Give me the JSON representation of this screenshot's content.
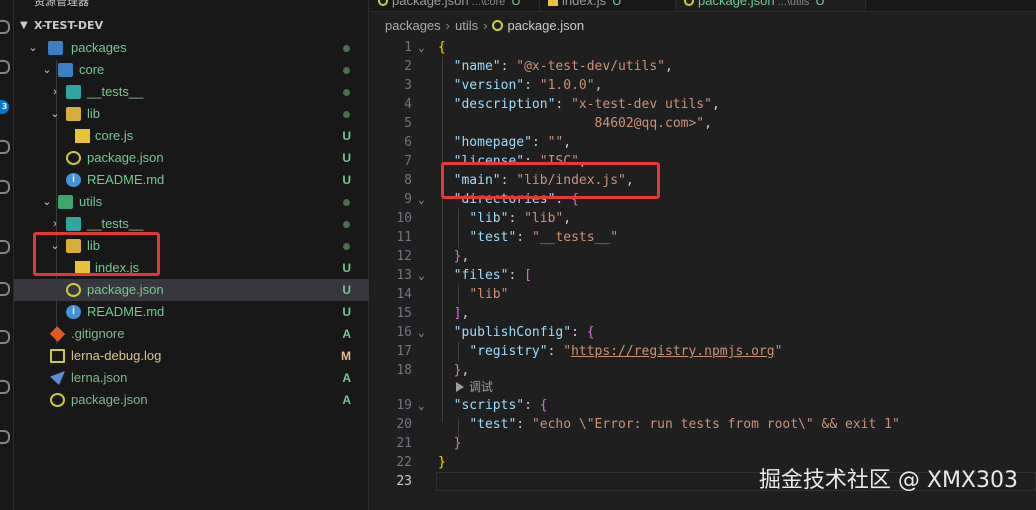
{
  "explorer": {
    "title": "资源管理器",
    "section": "X-TEST-DEV",
    "items": [
      {
        "name": "packages",
        "status": "dot"
      },
      {
        "name": "core",
        "status": "dot"
      },
      {
        "name": "__tests__",
        "status": "dot"
      },
      {
        "name": "lib",
        "status": "dot"
      },
      {
        "name": "core.js",
        "status": "U"
      },
      {
        "name": "package.json",
        "status": "U"
      },
      {
        "name": "README.md",
        "status": "U"
      },
      {
        "name": "utils",
        "status": "dot"
      },
      {
        "name": "__tests__",
        "status": "dot"
      },
      {
        "name": "lib",
        "status": "dot"
      },
      {
        "name": "index.js",
        "status": "U"
      },
      {
        "name": "package.json",
        "status": "U"
      },
      {
        "name": "README.md",
        "status": "U"
      },
      {
        "name": ".gitignore",
        "status": "A"
      },
      {
        "name": "lerna-debug.log",
        "status": "M"
      },
      {
        "name": "lerna.json",
        "status": "A"
      },
      {
        "name": "package.json",
        "status": "A"
      }
    ]
  },
  "tabs": [
    {
      "label": "package.json",
      "sub": "...\\core",
      "count": "U"
    },
    {
      "label": "index.js",
      "sub": "",
      "count": "U"
    },
    {
      "label": "package.json",
      "sub": "...\\utils",
      "count": "U"
    }
  ],
  "breadcrumb": [
    "packages",
    "utils",
    "package.json"
  ],
  "line_numbers": [
    "1",
    "2",
    "3",
    "4",
    "5",
    "6",
    "7",
    "8",
    "9",
    "10",
    "11",
    "12",
    "13",
    "14",
    "15",
    "16",
    "17",
    "18",
    "19",
    "20",
    "21",
    "22",
    "23"
  ],
  "code": {
    "l1": "{",
    "l2_key": "\"name\"",
    "l2_val": "\"@x-test-dev/utils\"",
    "l3_key": "\"version\"",
    "l3_val": "\"1.0.0\"",
    "l4_key": "\"description\"",
    "l4_val": "\"x-test-dev utils\"",
    "l5_val": "84602@qq.com>\"",
    "l6_key": "\"homepage\"",
    "l6_val": "\"\"",
    "l7_key": "\"license\"",
    "l7_val": "\"ISC\"",
    "l8_key": "\"main\"",
    "l8_val": "\"lib/index.js\"",
    "l9_key": "\"directories\"",
    "l9_open": "{",
    "l10_key": "\"lib\"",
    "l10_val": "\"lib\"",
    "l11_key": "\"test\"",
    "l11_val": "\"__tests__\"",
    "l12_close": "}",
    "l13_key": "\"files\"",
    "l13_open": "[",
    "l14_val": "\"lib\"",
    "l15_close": "]",
    "l16_key": "\"publishConfig\"",
    "l16_open": "{",
    "l17_key": "\"registry\"",
    "l17_q1": "\"",
    "l17_url": "https://registry.npmjs.org",
    "l17_q2": "\"",
    "l18_close": "}",
    "lens": "调试",
    "l19_key": "\"scripts\"",
    "l19_open": "{",
    "l20_key": "\"test\"",
    "l20_val": "\"echo \\\"Error: run tests from root\\\" && exit 1\"",
    "l21_close": "}",
    "l22": "}"
  },
  "watermark": "掘金技术社区 @ XMX303"
}
